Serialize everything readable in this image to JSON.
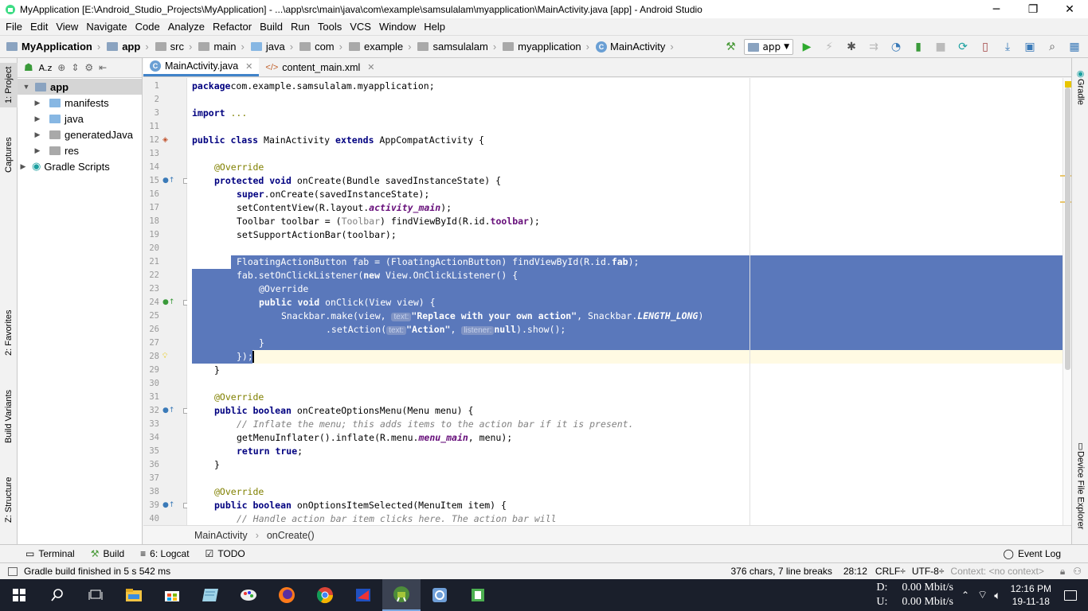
{
  "window": {
    "title": "MyApplication [E:\\Android_Studio_Projects\\MyApplication] - ...\\app\\src\\main\\java\\com\\example\\samsulalam\\myapplication\\MainActivity.java [app] - Android Studio",
    "minimize": "─",
    "maximize": "❐",
    "close": "✕"
  },
  "menu": [
    "File",
    "Edit",
    "View",
    "Navigate",
    "Code",
    "Analyze",
    "Refactor",
    "Build",
    "Run",
    "Tools",
    "VCS",
    "Window",
    "Help"
  ],
  "breadcrumbs": [
    "MyApplication",
    "app",
    "src",
    "main",
    "java",
    "com",
    "example",
    "samsulalam",
    "myapplication",
    "MainActivity"
  ],
  "run_config": "app",
  "left_tabs": [
    "1: Project",
    "Captures",
    "2: Favorites",
    "Build Variants",
    "Z: Structure"
  ],
  "right_tabs": [
    "Gradle",
    "Device File Explorer"
  ],
  "project_panel": {
    "toolbar_sort": "A.z",
    "tree": [
      {
        "label": "app",
        "level": 0,
        "expanded": true,
        "selected": true
      },
      {
        "label": "manifests",
        "level": 1,
        "expanded": false
      },
      {
        "label": "java",
        "level": 1,
        "expanded": false
      },
      {
        "label": "generatedJava",
        "level": 1,
        "expanded": false
      },
      {
        "label": "res",
        "level": 1,
        "expanded": false
      },
      {
        "label": "Gradle Scripts",
        "level": 0,
        "expanded": false
      }
    ]
  },
  "editor_tabs": [
    {
      "label": "MainActivity.java",
      "active": true
    },
    {
      "label": "content_main.xml",
      "active": false
    }
  ],
  "line_numbers": [
    "1",
    "2",
    "3",
    "11",
    "12",
    "13",
    "14",
    "15",
    "16",
    "17",
    "18",
    "19",
    "20",
    "21",
    "22",
    "23",
    "24",
    "25",
    "26",
    "27",
    "28",
    "29",
    "30",
    "31",
    "32",
    "33",
    "34",
    "35",
    "36",
    "37",
    "38",
    "39",
    "40"
  ],
  "code_lines": [
    [
      [
        "kw",
        "package"
      ],
      [
        "",
        "com.example.samsulalam.myapplication;"
      ]
    ],
    [],
    [
      [
        "kw",
        "import"
      ],
      [
        "",
        ""
      ],
      [
        "ann",
        "..."
      ]
    ],
    [],
    [
      [
        "kw",
        "public class"
      ],
      [
        "",
        " MainActivity "
      ],
      [
        "kw",
        "extends"
      ],
      [
        "",
        " AppCompatActivity {"
      ]
    ],
    [],
    [
      [
        "",
        ""
      ],
      [
        "ann",
        "@Override"
      ]
    ],
    [
      [
        "",
        ""
      ],
      [
        "kw",
        "protected void"
      ],
      [
        "",
        " onCreate(Bundle savedInstanceState) {"
      ]
    ],
    [
      [
        "",
        ""
      ],
      [
        "kw",
        "super"
      ],
      [
        "",
        ".onCreate(savedInstanceState);"
      ]
    ],
    [
      [
        "",
        "setContentView(R.layout."
      ],
      [
        "fld",
        "activity_main"
      ],
      [
        "",
        ");"
      ]
    ],
    [
      [
        "",
        "Toolbar toolbar = ("
      ],
      [
        "cast",
        "Toolbar"
      ],
      [
        "",
        ") findViewById(R.id."
      ],
      [
        "fldn",
        "toolbar"
      ],
      [
        "",
        ");"
      ]
    ],
    [
      [
        "",
        "setSupportActionBar(toolbar);"
      ]
    ],
    [],
    [
      [
        "",
        "FloatingActionButton fab = (FloatingActionButton) findViewById(R.id."
      ],
      [
        "fldn",
        "fab"
      ],
      [
        "",
        ");"
      ]
    ],
    [
      [
        "",
        "fab.setOnClickListener("
      ],
      [
        "kw",
        "new"
      ],
      [
        "",
        " View.OnClickListener() {"
      ]
    ],
    [
      [
        "ann",
        "@Override"
      ]
    ],
    [
      [
        "kw",
        "public void"
      ],
      [
        "",
        " onClick(View view) {"
      ]
    ],
    [
      [
        "",
        "Snackbar.make(view, "
      ],
      [
        "hint",
        "text:"
      ],
      [
        "str",
        "\"Replace with your own action\""
      ],
      [
        "",
        ", Snackbar."
      ],
      [
        "fld",
        "LENGTH_LONG"
      ],
      [
        "",
        ")"
      ]
    ],
    [
      [
        "",
        ".setAction("
      ],
      [
        "hint",
        "text:"
      ],
      [
        "str",
        "\"Action\""
      ],
      [
        "",
        ", "
      ],
      [
        "hint",
        "listener:"
      ],
      [
        "kw",
        "null"
      ],
      [
        "",
        ").show();"
      ]
    ],
    [
      [
        "",
        "}"
      ]
    ],
    [
      [
        "",
        "});"
      ]
    ],
    [
      [
        "",
        "}"
      ]
    ],
    [],
    [
      [
        "ann",
        "@Override"
      ]
    ],
    [
      [
        "kw",
        "public boolean"
      ],
      [
        "",
        " onCreateOptionsMenu(Menu menu) {"
      ]
    ],
    [
      [
        "cmt",
        "// Inflate the menu; this adds items to the action bar if it is present."
      ]
    ],
    [
      [
        "",
        "getMenuInflater().inflate(R.menu."
      ],
      [
        "fld",
        "menu_main"
      ],
      [
        "",
        ", menu);"
      ]
    ],
    [
      [
        "kw",
        "return true"
      ],
      [
        "",
        ";"
      ]
    ],
    [
      [
        "",
        "}"
      ]
    ],
    [],
    [
      [
        "ann",
        "@Override"
      ]
    ],
    [
      [
        "kw",
        "public boolean"
      ],
      [
        "",
        " onOptionsItemSelected(MenuItem item) {"
      ]
    ],
    [
      [
        "cmt",
        "// Handle action bar item clicks here. The action bar will"
      ]
    ]
  ],
  "editor_breadcrumb": [
    "MainActivity",
    "onCreate()"
  ],
  "bottom_tools": [
    "Terminal",
    "Build",
    "6: Logcat",
    "TODO"
  ],
  "event_log": "Event Log",
  "status": {
    "message": "Gradle build finished in 5 s 542 ms",
    "selection": "376 chars, 7 line breaks",
    "position": "28:12",
    "line_sep": "CRLF÷",
    "encoding": "UTF-8÷",
    "context": "Context: <no context>"
  },
  "taskbar": {
    "net_down_label": "D:",
    "net_down": "0.00 Mbit/s",
    "net_up_label": "U:",
    "net_up": "0.00 Mbit/s",
    "time": "12:16 PM",
    "date": "19-11-18"
  },
  "colors": {
    "selection": "#4c6db5",
    "keyword": "#000080",
    "annotation": "#808000",
    "string": "#008000",
    "taskbar": "#1a1f2b"
  }
}
